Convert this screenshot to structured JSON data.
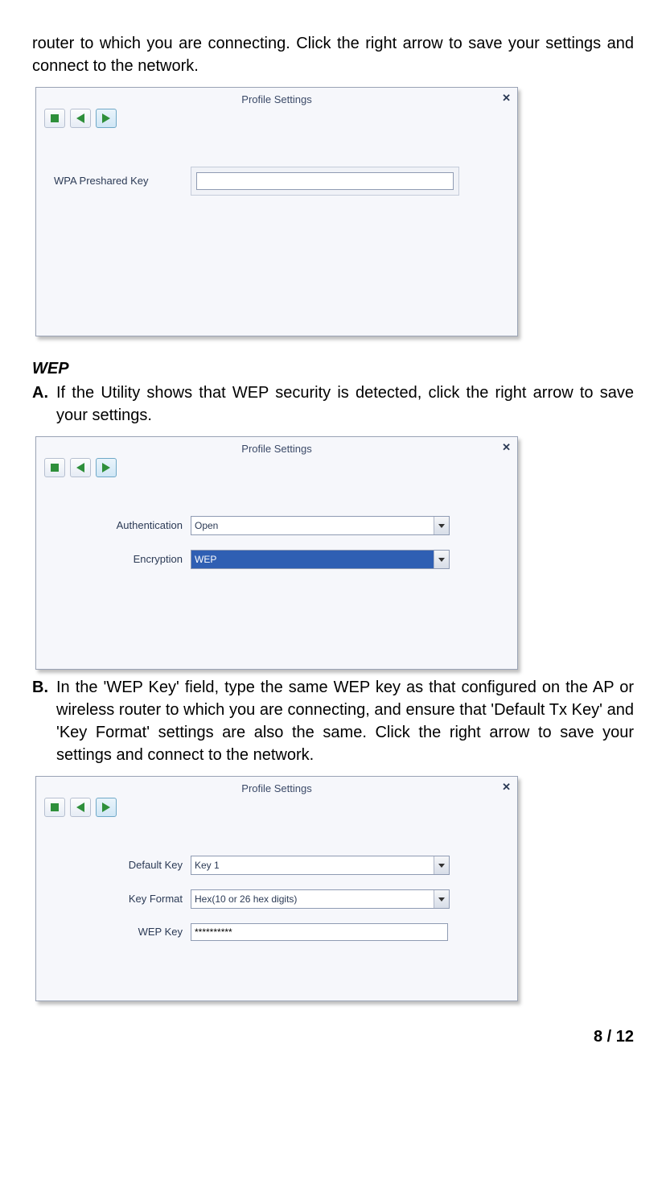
{
  "intro": "router to which you are connecting. Click the right arrow to save your settings and connect to the network.",
  "dlg1": {
    "title": "Profile Settings",
    "close": "✕",
    "field_label": "WPA Preshared Key",
    "field_value": ""
  },
  "wep_heading": "WEP",
  "stepA": {
    "marker": "A.",
    "text": "If the Utility shows that WEP security is detected, click the right arrow to save your settings."
  },
  "dlg2": {
    "title": "Profile Settings",
    "close": "✕",
    "auth_label": "Authentication",
    "auth_value": "Open",
    "enc_label": "Encryption",
    "enc_value": "WEP"
  },
  "stepB": {
    "marker": "B.",
    "text": "In the 'WEP Key' field, type the same WEP key as that configured on the AP or wireless router to which you are connecting, and ensure that 'Default Tx Key' and 'Key Format' settings are also the same. Click the right arrow to save your settings and connect to the network."
  },
  "dlg3": {
    "title": "Profile Settings",
    "close": "✕",
    "defkey_label": "Default Key",
    "defkey_value": "Key 1",
    "keyfmt_label": "Key Format",
    "keyfmt_value": "Hex(10 or 26 hex digits)",
    "wepkey_label": "WEP Key",
    "wepkey_value": "**********"
  },
  "pager": "8 / 12"
}
